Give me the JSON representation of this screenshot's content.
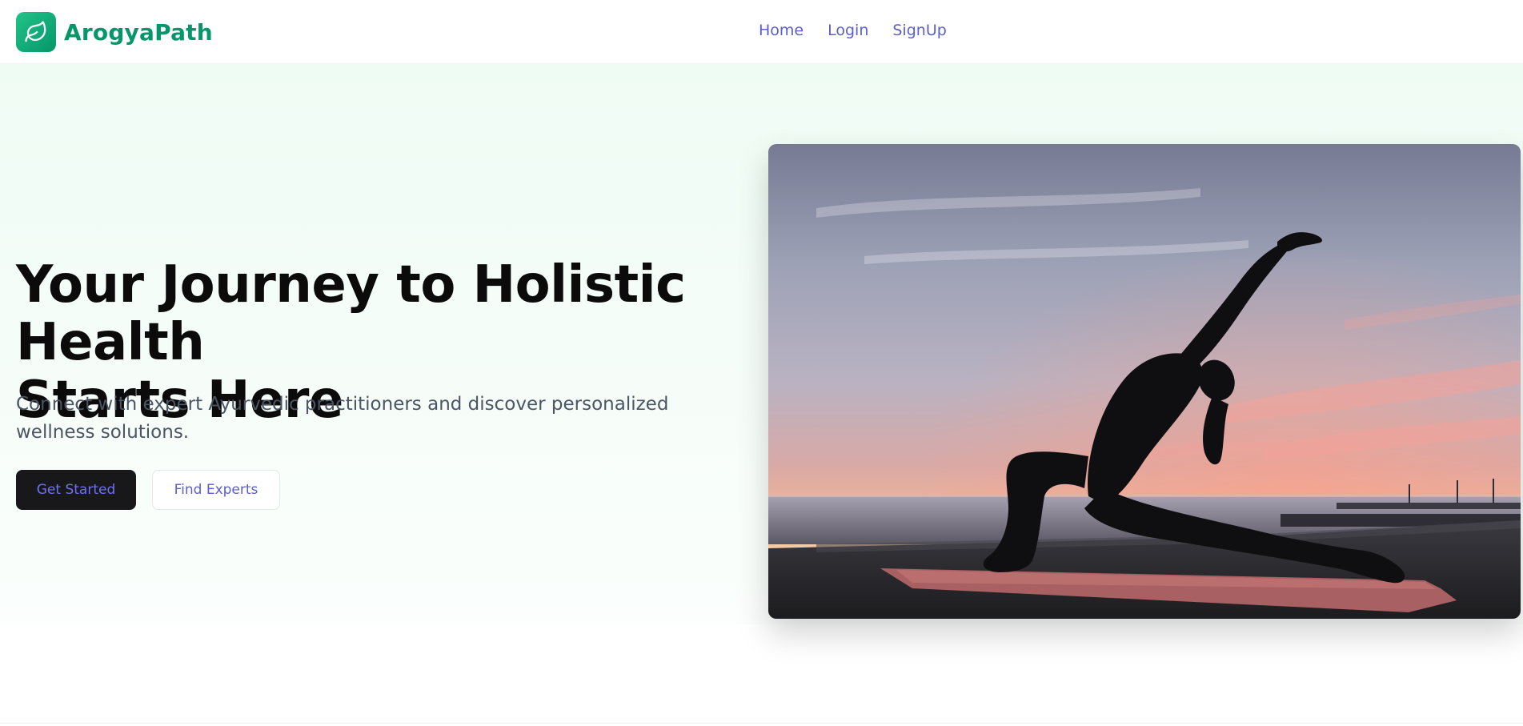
{
  "brand": {
    "name": "ArogyaPath",
    "logo_icon": "leaf-icon",
    "color": "#059669"
  },
  "nav": {
    "items": [
      {
        "label": "Home"
      },
      {
        "label": "Login"
      },
      {
        "label": "SignUp"
      }
    ]
  },
  "hero": {
    "headline_line1": "Your Journey to Holistic Health",
    "headline_line2": "Starts Here",
    "subtitle": "Connect with expert Ayurvedic practitioners and discover personalized wellness solutions.",
    "primary_button": "Get Started",
    "secondary_button": "Find Experts",
    "image_alt": "Woman doing yoga pose silhouetted against sunset by the sea"
  },
  "colors": {
    "accent_link": "#5b5fc7",
    "brand_green": "#059669",
    "hero_bg": "#effcf4"
  }
}
